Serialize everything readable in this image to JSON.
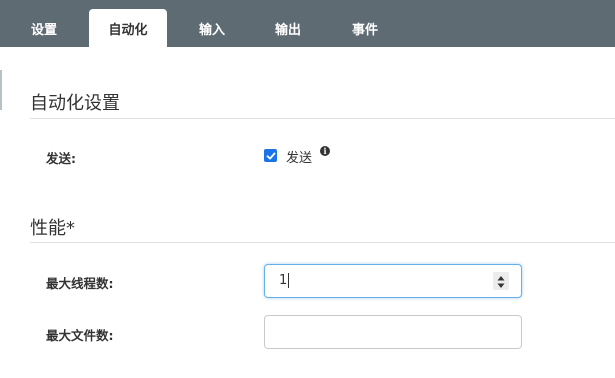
{
  "tabs": [
    {
      "label": "设置",
      "active": false
    },
    {
      "label": "自动化",
      "active": true
    },
    {
      "label": "输入",
      "active": false
    },
    {
      "label": "输出",
      "active": false
    },
    {
      "label": "事件",
      "active": false
    }
  ],
  "automation": {
    "title": "自动化设置",
    "send_label": "发送:",
    "send_checkbox_label": "发送",
    "send_checked": true
  },
  "performance": {
    "title": "性能*",
    "max_threads_label": "最大线程数:",
    "max_threads_value": "1",
    "max_files_label": "最大文件数:",
    "max_files_value": ""
  },
  "icons": {
    "info": "info-icon",
    "check": "checkmark-icon",
    "spinner": "spinner-arrows-icon"
  },
  "colors": {
    "tabbar": "#5f6b73",
    "checkbox": "#1a73e8",
    "focus_border": "#66afe9"
  }
}
